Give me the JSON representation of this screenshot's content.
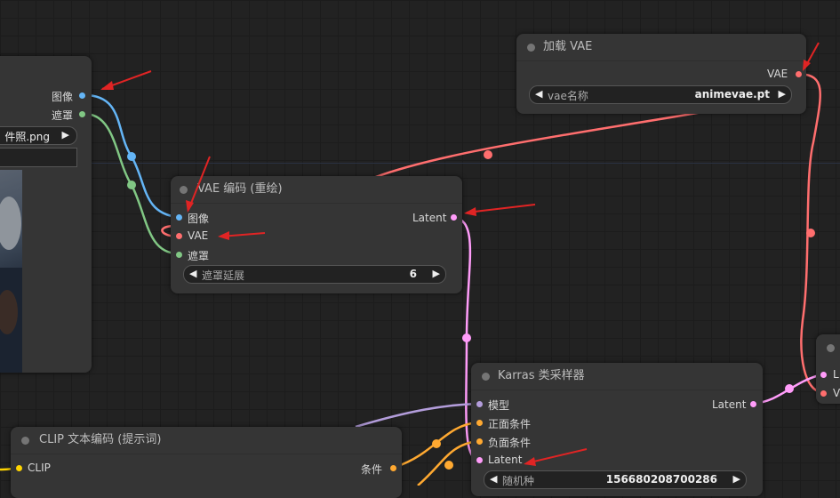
{
  "colors": {
    "image": "#64b5f6",
    "mask": "#81c784",
    "vae": "#ff6e6e",
    "latent": "#ff9cf9",
    "model": "#b39ddb",
    "conditioning": "#ffa931",
    "clip": "#ffd500",
    "annotation_arrow": "#e02424"
  },
  "load_image_node": {
    "output_image": "图像",
    "output_mask": "遮罩",
    "file_value": "件照.png",
    "upload_arrow": "▶"
  },
  "load_vae_node": {
    "title": "加载 VAE",
    "output_vae": "VAE",
    "vae_name_label": "vae名称",
    "vae_name_value": "animevae.pt",
    "left_arrow": "◀",
    "right_arrow": "▶"
  },
  "vae_encode_node": {
    "title": "VAE 编码 (重绘)",
    "input_image": "图像",
    "input_vae": "VAE",
    "input_mask": "遮罩",
    "output_latent": "Latent",
    "grow_mask_label": "遮罩延展",
    "grow_mask_value": "6",
    "left_arrow": "◀",
    "right_arrow": "▶"
  },
  "ksampler_node": {
    "title": "Karras 类采样器",
    "input_model": "模型",
    "input_positive": "正面条件",
    "input_negative": "负面条件",
    "input_latent": "Latent",
    "output_latent": "Latent",
    "seed_label": "随机种",
    "seed_value": "156680208700286",
    "left_arrow": "◀",
    "right_arrow": "▶"
  },
  "clip_text_node": {
    "title": "CLIP 文本编码 (提示词)",
    "input_clip": "CLIP",
    "output_conditioning": "条件"
  },
  "vae_decode_node": {
    "input_latent": "L",
    "input_vae": "V"
  }
}
